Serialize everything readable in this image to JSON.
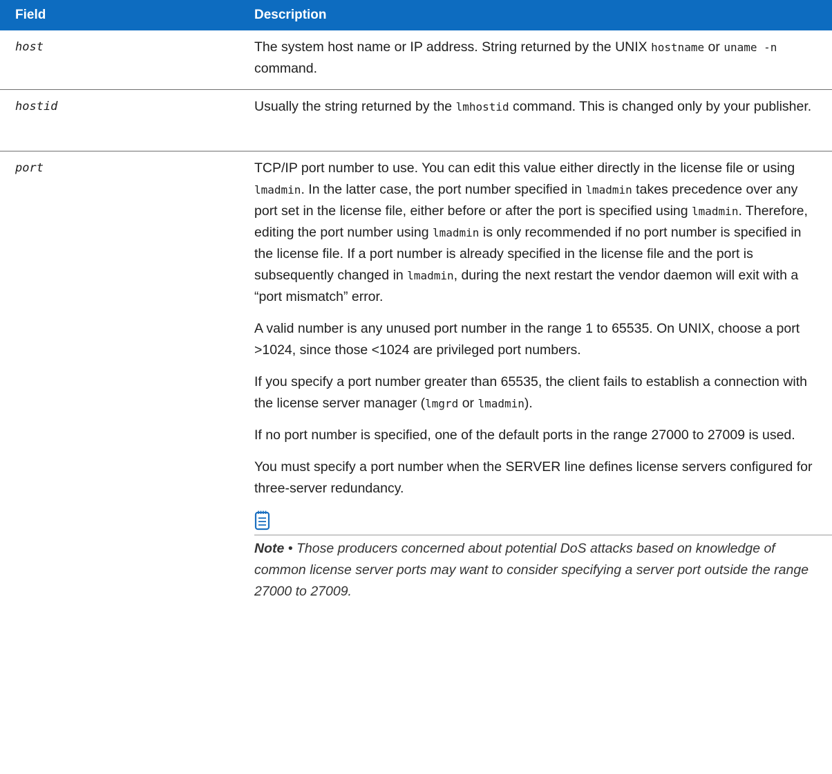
{
  "header": {
    "field": "Field",
    "description": "Description"
  },
  "rows": [
    {
      "field": "host",
      "desc": {
        "t1": "The system host name or IP address. String returned by the UNIX ",
        "c1": "hostname",
        "t2": " or ",
        "c2": "uname -n",
        "t3": " command."
      }
    },
    {
      "field": "hostid",
      "desc": {
        "t1": "Usually the string returned by the ",
        "c1": "lmhostid",
        "t2": " command. This is changed only by your publisher."
      }
    },
    {
      "field": "port",
      "p1": {
        "t1": "TCP/IP port number to use. You can edit this value either directly in the license file or using ",
        "c1": "lmadmin",
        "t2": ". In the latter case, the port number specified in ",
        "c2": "lmadmin",
        "t3": " takes precedence over any port set in the license file, either before or after the port is specified using ",
        "c3": "lmadmin",
        "t4": ". Therefore, editing the port number using ",
        "c4": "lmadmin",
        "t5": " is only recommended if no port number is specified in the license file. If a port number is already specified in the license file and the port is subsequently changed in ",
        "c5": "lmadmin",
        "t6": ", during the next restart the vendor daemon will exit with a “port mismatch” error."
      },
      "p2": "A valid number is any unused port number in the range 1 to 65535. On UNIX, choose a port >1024, since those <1024 are privileged port numbers.",
      "p3": {
        "t1": "If you specify a port number greater than 65535, the client fails to establish a connection with the license server manager (",
        "c1": "lmgrd",
        "t2": " or ",
        "c2": "lmadmin",
        "t3": ")."
      },
      "p4": "If no port number is specified, one of the default ports in the range 27000 to 27009 is used.",
      "p5": "You must specify a port number when the SERVER line defines license servers configured for three-server redundancy.",
      "note": {
        "label": "Note",
        "separator": " • ",
        "text": "Those producers concerned about potential DoS attacks based on knowledge of common license server ports may want to consider specifying a server port outside the range 27000 to 27009."
      }
    }
  ],
  "colors": {
    "header_bg": "#0d6cc0",
    "icon": "#1a6fc0"
  },
  "icons": {
    "note": "note-icon"
  }
}
